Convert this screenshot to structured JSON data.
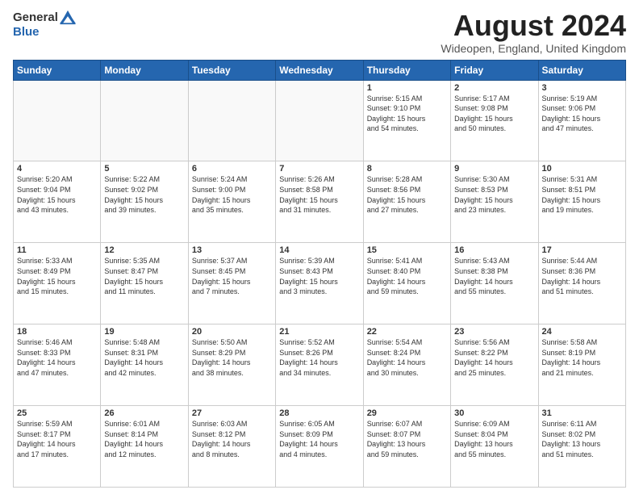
{
  "header": {
    "logo_general": "General",
    "logo_blue": "Blue",
    "month_year": "August 2024",
    "location": "Wideopen, England, United Kingdom"
  },
  "days_of_week": [
    "Sunday",
    "Monday",
    "Tuesday",
    "Wednesday",
    "Thursday",
    "Friday",
    "Saturday"
  ],
  "weeks": [
    [
      {
        "day": "",
        "info": ""
      },
      {
        "day": "",
        "info": ""
      },
      {
        "day": "",
        "info": ""
      },
      {
        "day": "",
        "info": ""
      },
      {
        "day": "1",
        "info": "Sunrise: 5:15 AM\nSunset: 9:10 PM\nDaylight: 15 hours\nand 54 minutes."
      },
      {
        "day": "2",
        "info": "Sunrise: 5:17 AM\nSunset: 9:08 PM\nDaylight: 15 hours\nand 50 minutes."
      },
      {
        "day": "3",
        "info": "Sunrise: 5:19 AM\nSunset: 9:06 PM\nDaylight: 15 hours\nand 47 minutes."
      }
    ],
    [
      {
        "day": "4",
        "info": "Sunrise: 5:20 AM\nSunset: 9:04 PM\nDaylight: 15 hours\nand 43 minutes."
      },
      {
        "day": "5",
        "info": "Sunrise: 5:22 AM\nSunset: 9:02 PM\nDaylight: 15 hours\nand 39 minutes."
      },
      {
        "day": "6",
        "info": "Sunrise: 5:24 AM\nSunset: 9:00 PM\nDaylight: 15 hours\nand 35 minutes."
      },
      {
        "day": "7",
        "info": "Sunrise: 5:26 AM\nSunset: 8:58 PM\nDaylight: 15 hours\nand 31 minutes."
      },
      {
        "day": "8",
        "info": "Sunrise: 5:28 AM\nSunset: 8:56 PM\nDaylight: 15 hours\nand 27 minutes."
      },
      {
        "day": "9",
        "info": "Sunrise: 5:30 AM\nSunset: 8:53 PM\nDaylight: 15 hours\nand 23 minutes."
      },
      {
        "day": "10",
        "info": "Sunrise: 5:31 AM\nSunset: 8:51 PM\nDaylight: 15 hours\nand 19 minutes."
      }
    ],
    [
      {
        "day": "11",
        "info": "Sunrise: 5:33 AM\nSunset: 8:49 PM\nDaylight: 15 hours\nand 15 minutes."
      },
      {
        "day": "12",
        "info": "Sunrise: 5:35 AM\nSunset: 8:47 PM\nDaylight: 15 hours\nand 11 minutes."
      },
      {
        "day": "13",
        "info": "Sunrise: 5:37 AM\nSunset: 8:45 PM\nDaylight: 15 hours\nand 7 minutes."
      },
      {
        "day": "14",
        "info": "Sunrise: 5:39 AM\nSunset: 8:43 PM\nDaylight: 15 hours\nand 3 minutes."
      },
      {
        "day": "15",
        "info": "Sunrise: 5:41 AM\nSunset: 8:40 PM\nDaylight: 14 hours\nand 59 minutes."
      },
      {
        "day": "16",
        "info": "Sunrise: 5:43 AM\nSunset: 8:38 PM\nDaylight: 14 hours\nand 55 minutes."
      },
      {
        "day": "17",
        "info": "Sunrise: 5:44 AM\nSunset: 8:36 PM\nDaylight: 14 hours\nand 51 minutes."
      }
    ],
    [
      {
        "day": "18",
        "info": "Sunrise: 5:46 AM\nSunset: 8:33 PM\nDaylight: 14 hours\nand 47 minutes."
      },
      {
        "day": "19",
        "info": "Sunrise: 5:48 AM\nSunset: 8:31 PM\nDaylight: 14 hours\nand 42 minutes."
      },
      {
        "day": "20",
        "info": "Sunrise: 5:50 AM\nSunset: 8:29 PM\nDaylight: 14 hours\nand 38 minutes."
      },
      {
        "day": "21",
        "info": "Sunrise: 5:52 AM\nSunset: 8:26 PM\nDaylight: 14 hours\nand 34 minutes."
      },
      {
        "day": "22",
        "info": "Sunrise: 5:54 AM\nSunset: 8:24 PM\nDaylight: 14 hours\nand 30 minutes."
      },
      {
        "day": "23",
        "info": "Sunrise: 5:56 AM\nSunset: 8:22 PM\nDaylight: 14 hours\nand 25 minutes."
      },
      {
        "day": "24",
        "info": "Sunrise: 5:58 AM\nSunset: 8:19 PM\nDaylight: 14 hours\nand 21 minutes."
      }
    ],
    [
      {
        "day": "25",
        "info": "Sunrise: 5:59 AM\nSunset: 8:17 PM\nDaylight: 14 hours\nand 17 minutes."
      },
      {
        "day": "26",
        "info": "Sunrise: 6:01 AM\nSunset: 8:14 PM\nDaylight: 14 hours\nand 12 minutes."
      },
      {
        "day": "27",
        "info": "Sunrise: 6:03 AM\nSunset: 8:12 PM\nDaylight: 14 hours\nand 8 minutes."
      },
      {
        "day": "28",
        "info": "Sunrise: 6:05 AM\nSunset: 8:09 PM\nDaylight: 14 hours\nand 4 minutes."
      },
      {
        "day": "29",
        "info": "Sunrise: 6:07 AM\nSunset: 8:07 PM\nDaylight: 13 hours\nand 59 minutes."
      },
      {
        "day": "30",
        "info": "Sunrise: 6:09 AM\nSunset: 8:04 PM\nDaylight: 13 hours\nand 55 minutes."
      },
      {
        "day": "31",
        "info": "Sunrise: 6:11 AM\nSunset: 8:02 PM\nDaylight: 13 hours\nand 51 minutes."
      }
    ]
  ]
}
